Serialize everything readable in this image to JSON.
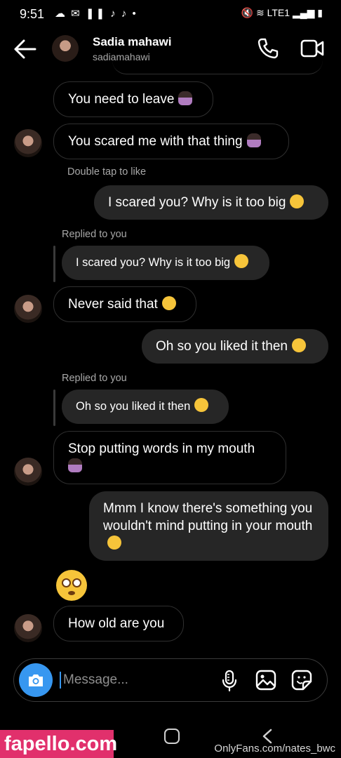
{
  "status_bar": {
    "time": "9:51",
    "left_icons": "☁ ✉ ❚❚ ♪ ♪ •",
    "right_icons": "🔇 ≋ LTE1 ▂▄▆ ▮"
  },
  "header": {
    "name": "Sadia mahawi",
    "username": "sadiamahawi"
  },
  "messages": [
    {
      "kind": "in",
      "text": "You need to leave",
      "emoji": "person-icon"
    },
    {
      "kind": "in",
      "text": "You scared me with that thing",
      "emoji": "person-shrug-icon"
    },
    {
      "kind": "meta",
      "text": "Double tap to like"
    },
    {
      "kind": "out",
      "text": "I scared you? Why is it too big",
      "emoji": "face-hand-over-mouth-icon"
    },
    {
      "kind": "meta",
      "text": "Replied to you"
    },
    {
      "kind": "quote",
      "text": "I scared you? Why is it too big",
      "emoji": "face-hand-over-mouth-icon"
    },
    {
      "kind": "in",
      "text": "Never said that",
      "emoji": "face-rolling-eyes-icon"
    },
    {
      "kind": "out",
      "text": "Oh so you liked it then",
      "emoji": "smirking-face-icon"
    },
    {
      "kind": "meta",
      "text": "Replied to you"
    },
    {
      "kind": "quote",
      "text": "Oh so you liked it then",
      "emoji": "smirking-face-icon"
    },
    {
      "kind": "in",
      "text": "Stop putting words in my mouth",
      "emoji": "person-icon"
    },
    {
      "kind": "out",
      "text": "Mmm I know there's something you wouldn't mind putting in your mouth",
      "emoji": "smirking-face-icon"
    },
    {
      "kind": "emoji",
      "emoji": "flushed-face-icon"
    },
    {
      "kind": "in",
      "text": "How old are you"
    }
  ],
  "composer": {
    "placeholder": "Message..."
  },
  "watermarks": {
    "left": "fapello.com",
    "right": "OnlyFans.com/nates_bwc"
  },
  "colors": {
    "accent": "#3797f0",
    "bubble_out": "#262626",
    "background": "#000000"
  }
}
